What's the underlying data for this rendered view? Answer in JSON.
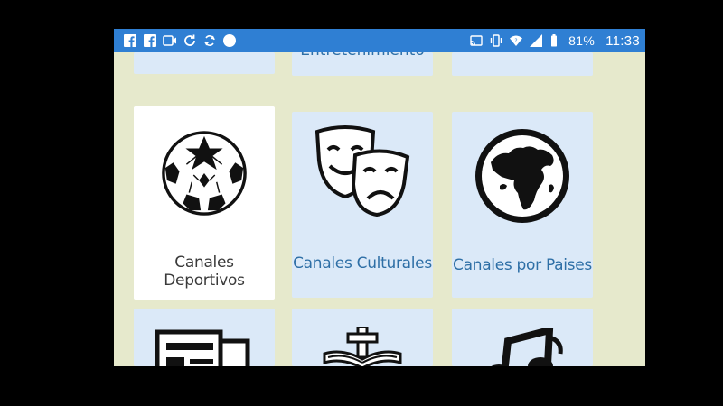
{
  "status_bar": {
    "left_icons": [
      "facebook-icon",
      "facebook-icon",
      "video-camera-icon",
      "sync-icon",
      "refresh-icon",
      "dot-icon"
    ],
    "right_icons": [
      "cast-icon",
      "vibrate-icon",
      "wifi-icon",
      "signal-icon",
      "battery-icon"
    ],
    "battery": "81%",
    "time": "11:33"
  },
  "tiles": {
    "top_partial_label": "Entretenimiento",
    "deportivos": {
      "label": "Canales Deportivos",
      "icon": "soccer-ball-icon"
    },
    "culturales": {
      "label": "Canales Culturales",
      "icon": "theater-masks-icon"
    },
    "paises": {
      "label": "Canales por Paises",
      "icon": "globe-icon"
    },
    "bottom_icons": [
      "newspaper-icon",
      "bible-cross-icon",
      "music-note-icon"
    ]
  },
  "colors": {
    "status_bar": "#2f7fd3",
    "tile_blue": "#dbe9f8",
    "label_blue": "#2e6fa6",
    "background": "#e6e9cc"
  }
}
